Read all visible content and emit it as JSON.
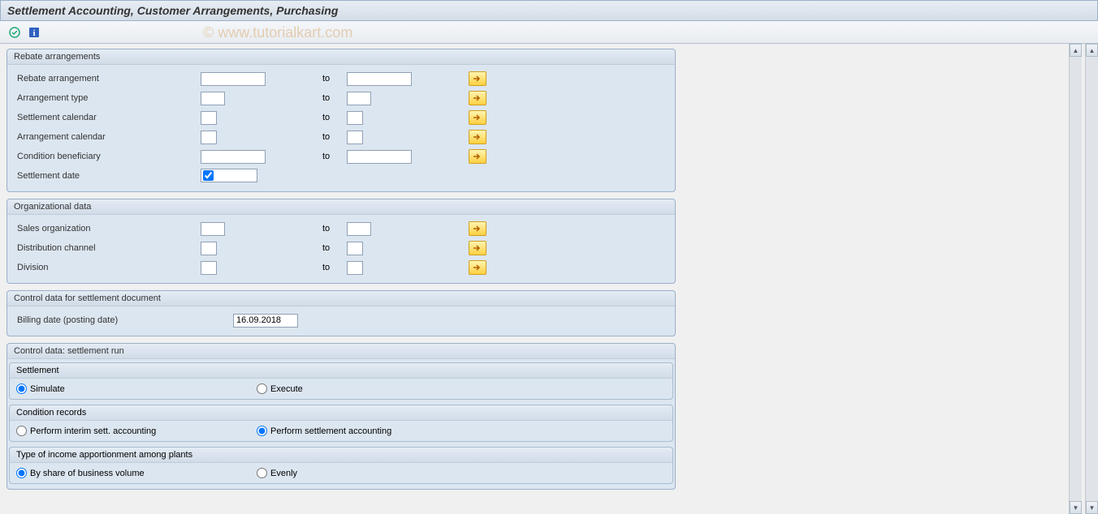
{
  "title": "Settlement Accounting, Customer Arrangements, Purchasing",
  "watermark": "© www.tutorialkart.com",
  "to_label": "to",
  "groups": {
    "rebate": {
      "title": "Rebate arrangements",
      "fields": {
        "rebate_arrangement": "Rebate arrangement",
        "arrangement_type": "Arrangement type",
        "settlement_calendar": "Settlement calendar",
        "arrangement_calendar": "Arrangement calendar",
        "condition_beneficiary": "Condition beneficiary",
        "settlement_date": "Settlement date"
      }
    },
    "org": {
      "title": "Organizational data",
      "fields": {
        "sales_org": "Sales organization",
        "dist_channel": "Distribution channel",
        "division": "Division"
      }
    },
    "control_doc": {
      "title": "Control data for settlement document",
      "fields": {
        "billing_date_label": "Billing date (posting date)",
        "billing_date_value": "16.09.2018"
      }
    },
    "control_run": {
      "title": "Control data: settlement run",
      "settlement": {
        "title": "Settlement",
        "simulate": "Simulate",
        "execute": "Execute"
      },
      "condition_records": {
        "title": "Condition records",
        "interim": "Perform interim sett. accounting",
        "settlement": "Perform settlement accounting"
      },
      "income_apportionment": {
        "title": "Type of income apportionment among plants",
        "by_share": "By share of business volume",
        "evenly": "Evenly"
      }
    }
  }
}
